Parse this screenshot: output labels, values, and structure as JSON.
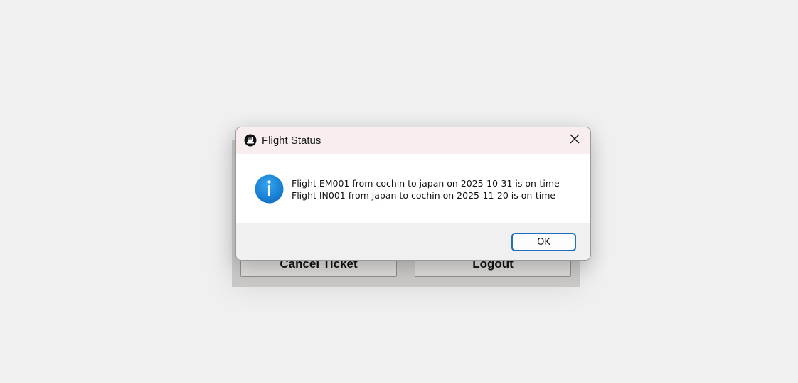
{
  "background_window": {
    "buttons": {
      "cancel_ticket": "Cancel Ticket",
      "logout": "Logout"
    }
  },
  "dialog": {
    "title": "Flight Status",
    "title_icon": "app-icon",
    "message_lines": [
      "Flight EM001 from cochin to japan on 2025-10-31 is on-time",
      "Flight IN001 from japan to cochin on 2025-11-20 is on-time"
    ],
    "message_icon": "info-icon",
    "ok_label": "OK",
    "close_icon": "close-icon"
  },
  "colors": {
    "titlebar": "#f8eeee",
    "ok_border": "#1f6fc1",
    "info_icon": "#1683d8"
  }
}
